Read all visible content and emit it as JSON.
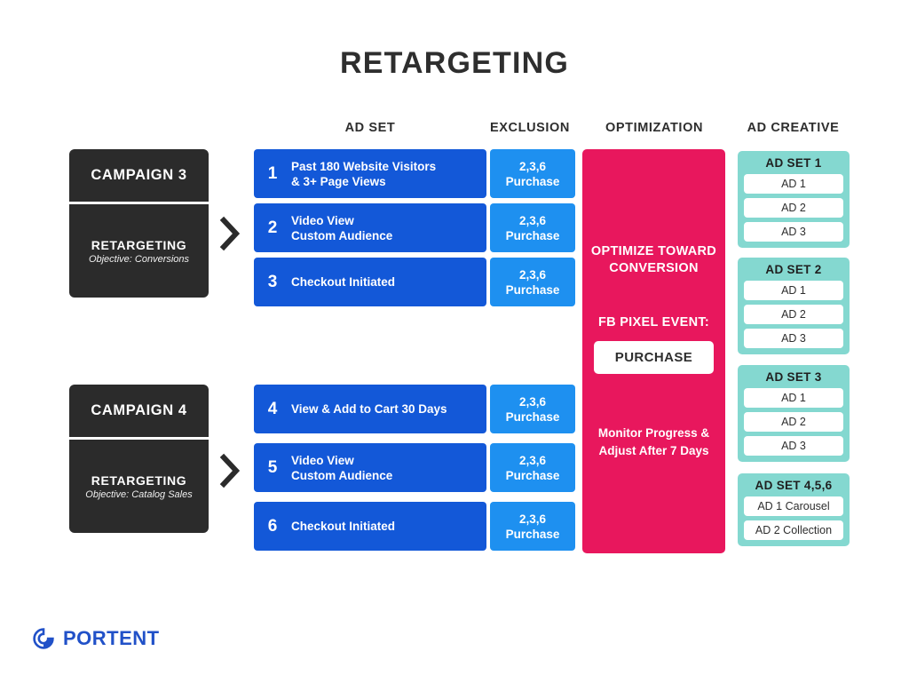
{
  "page": {
    "title": "RETARGETING",
    "background": "#ffffff"
  },
  "colors": {
    "campaign_dark": "#2b2b2b",
    "adset_blue": "#1358d8",
    "exclusion_blue": "#1e90f0",
    "optimization_pink": "#e8175d",
    "creative_teal": "#84d8d0",
    "logo_blue": "#2151c8",
    "title_text": "#2e2e2e"
  },
  "headers": {
    "ad_set": "AD SET",
    "exclusion": "EXCLUSION",
    "optimization": "OPTIMIZATION",
    "ad_creative": "AD CREATIVE"
  },
  "campaigns": [
    {
      "name": "CAMPAIGN 3",
      "type": "RETARGETING",
      "objective": "Objective: Conversions",
      "chevron_icon": "chevron-right-icon",
      "ad_sets": [
        {
          "number": "1",
          "label": "Past 180 Website Visitors\n& 3+ Page Views",
          "exclusion_codes": "2,3,6",
          "exclusion_event": "Purchase"
        },
        {
          "number": "2",
          "label": "Video View\nCustom Audience",
          "exclusion_codes": "2,3,6",
          "exclusion_event": "Purchase"
        },
        {
          "number": "3",
          "label": "Checkout Initiated",
          "exclusion_codes": "2,3,6",
          "exclusion_event": "Purchase"
        }
      ]
    },
    {
      "name": "CAMPAIGN 4",
      "type": "RETARGETING",
      "objective": "Objective: Catalog Sales",
      "chevron_icon": "chevron-right-icon",
      "ad_sets": [
        {
          "number": "4",
          "label": "View & Add to Cart 30 Days",
          "exclusion_codes": "2,3,6",
          "exclusion_event": "Purchase"
        },
        {
          "number": "5",
          "label": "Video View\nCustom Audience",
          "exclusion_codes": "2,3,6",
          "exclusion_event": "Purchase"
        },
        {
          "number": "6",
          "label": "Checkout Initiated",
          "exclusion_codes": "2,3,6",
          "exclusion_event": "Purchase"
        }
      ]
    }
  ],
  "optimization": {
    "heading": "OPTIMIZE TOWARD CONVERSION",
    "pixel_label": "FB PIXEL EVENT:",
    "pixel_value": "PURCHASE",
    "footer": "Monitor Progress & Adjust After 7 Days"
  },
  "ad_creative_groups": [
    {
      "title": "AD SET 1",
      "ads": [
        "AD 1",
        "AD 2",
        "AD 3"
      ]
    },
    {
      "title": "AD SET 2",
      "ads": [
        "AD 1",
        "AD 2",
        "AD 3"
      ]
    },
    {
      "title": "AD SET 3",
      "ads": [
        "AD 1",
        "AD 2",
        "AD 3"
      ]
    },
    {
      "title": "AD SET 4,5,6",
      "ads": [
        "AD 1 Carousel",
        "AD 2 Collection"
      ]
    }
  ],
  "logo": {
    "mark_icon": "portent-circle-logo-icon",
    "text": "PORTENT"
  }
}
